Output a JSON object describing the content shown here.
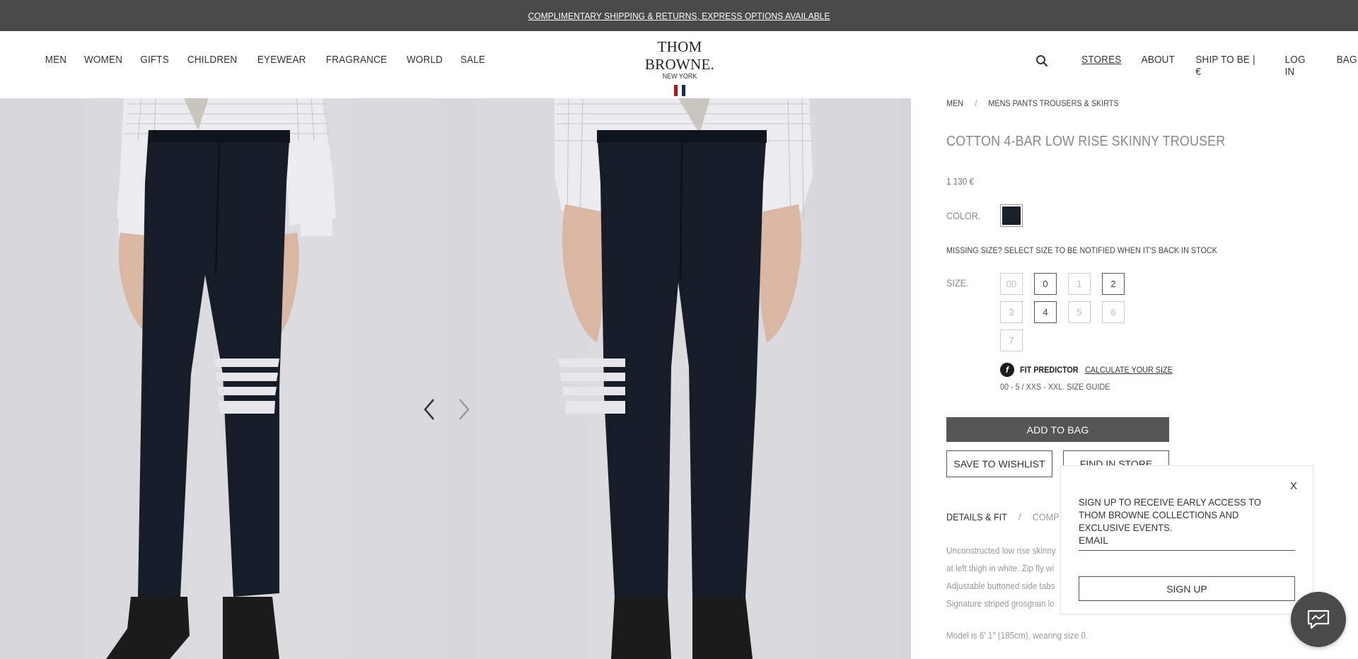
{
  "banner": {
    "text": "COMPLIMENTARY SHIPPING & RETURNS, EXPRESS OPTIONS AVAILABLE"
  },
  "nav": {
    "left": [
      "MEN",
      "WOMEN",
      "GIFTS",
      "CHILDREN",
      "EYEWEAR",
      "FRAGRANCE",
      "WORLD",
      "SALE"
    ],
    "right": [
      "STORES",
      "ABOUT",
      "SHIP TO BE | €",
      "LOG IN",
      "BAG"
    ],
    "active": "STORES",
    "search_icon": "search-icon"
  },
  "logo": {
    "brand": "THOM BROWNE.",
    "city": "NEW YORK",
    "flag_colors": [
      "#b5121b",
      "#ffffff",
      "#1f2a5c"
    ]
  },
  "gallery": {
    "prev_icon": "chevron-left-icon",
    "next_icon": "chevron-right-icon"
  },
  "breadcrumb": {
    "items": [
      "MEN",
      "/",
      "MENS PANTS TROUSERS & SKIRTS"
    ]
  },
  "product": {
    "title": "COTTON 4-BAR LOW RISE SKINNY TROUSER",
    "price": "1 130 €",
    "color_label": "COLOR.",
    "color_hex": "#1a1f2a",
    "missing_size": "MISSING SIZE? SELECT SIZE TO BE NOTIFIED WHEN IT'S BACK IN STOCK",
    "size_label": "SIZE.",
    "sizes": [
      {
        "label": "00",
        "available": false
      },
      {
        "label": "0",
        "available": true
      },
      {
        "label": "1",
        "available": false
      },
      {
        "label": "2",
        "available": true
      },
      {
        "label": "3",
        "available": false
      },
      {
        "label": "4",
        "available": true
      },
      {
        "label": "5",
        "available": false
      },
      {
        "label": "6",
        "available": false
      },
      {
        "label": "7",
        "available": false
      }
    ],
    "fit_predictor": "FIT PREDICTOR",
    "calculate": "CALCULATE YOUR SIZE",
    "size_guide": "00 - 5 / XXS - XXL. SIZE GUIDE",
    "add_to_bag": "ADD TO BAG",
    "save_wishlist": "SAVE TO WISHLIST",
    "find_store": "FIND IN STORE",
    "tabs": [
      "DETAILS & FIT",
      "/",
      "COMP"
    ],
    "description": [
      "Unconstructed low rise skinny",
      "at left thigh in white. Zip fly wi",
      "Adjustable buttoned side tabs",
      "Signature striped grosgrain lo"
    ],
    "model": "Model is 6' 1\" (185cm), wearing size 0."
  },
  "popup": {
    "close": "X",
    "message": "SIGN UP TO RECEIVE EARLY ACCESS TO THOM BROWNE COLLECTIONS AND EXCLUSIVE EVENTS.",
    "email_placeholder": "EMAIL",
    "signup": "SIGN UP"
  },
  "chat": {
    "icon": "chat-icon"
  }
}
